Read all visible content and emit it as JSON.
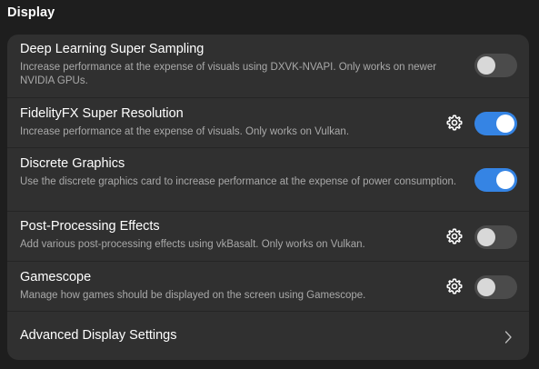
{
  "section": {
    "title": "Display"
  },
  "rows": [
    {
      "title": "Deep Learning Super Sampling",
      "subtitle": "Increase performance at the expense of visuals using DXVK-NVAPI. Only works on newer NVIDIA GPUs.",
      "toggle_on": false,
      "has_settings": false
    },
    {
      "title": "FidelityFX Super Resolution",
      "subtitle": "Increase performance at the expense of visuals. Only works on Vulkan.",
      "toggle_on": true,
      "has_settings": true
    },
    {
      "title": "Discrete Graphics",
      "subtitle": "Use the discrete graphics card to increase performance at the expense of power consumption.",
      "toggle_on": true,
      "has_settings": false
    },
    {
      "title": "Post-Processing Effects",
      "subtitle": "Add various post-processing effects using vkBasalt. Only works on Vulkan.",
      "toggle_on": false,
      "has_settings": true
    },
    {
      "title": "Gamescope",
      "subtitle": "Manage how games should be displayed on the screen using Gamescope.",
      "toggle_on": false,
      "has_settings": true
    }
  ],
  "advanced": {
    "label": "Advanced Display Settings"
  },
  "icons": {
    "settings": "gear-icon",
    "navigate": "chevron-right-icon"
  },
  "colors": {
    "accent": "#3584e4",
    "card": "#303030",
    "background": "#1e1e1e"
  }
}
